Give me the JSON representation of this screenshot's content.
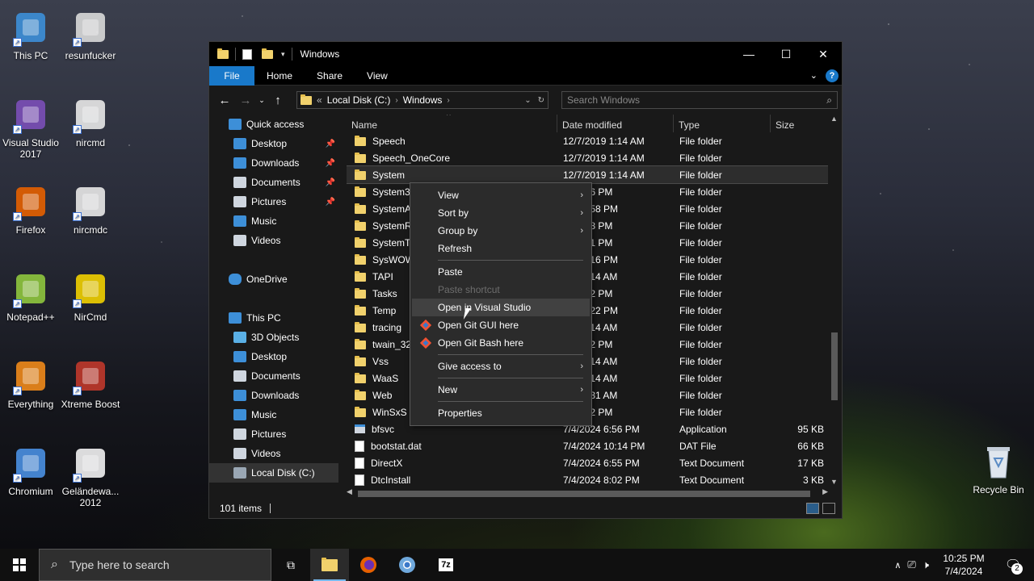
{
  "desktop": {
    "icons_left": [
      {
        "label": "This PC",
        "icon": "this-pc-icon"
      },
      {
        "label": "Visual Studio 2017",
        "icon": "visual-studio-icon"
      },
      {
        "label": "Firefox",
        "icon": "firefox-icon"
      },
      {
        "label": "Notepad++",
        "icon": "notepadpp-icon"
      },
      {
        "label": "Everything",
        "icon": "everything-icon"
      },
      {
        "label": "Chromium",
        "icon": "chromium-icon"
      }
    ],
    "icons_right": [
      {
        "label": "resunfucker",
        "icon": "gear-file-icon"
      },
      {
        "label": "nircmd",
        "icon": "nircmd-icon"
      },
      {
        "label": "nircmdc",
        "icon": "nircmdc-icon"
      },
      {
        "label": "NirCmd",
        "icon": "nircmd-question-icon"
      },
      {
        "label": "Xtreme Boost",
        "icon": "xtreme-boost-icon"
      },
      {
        "label": "Geländewa... 2012",
        "icon": "gelaendewagen-icon"
      }
    ],
    "recycle_bin": "Recycle Bin"
  },
  "explorer": {
    "title": "Windows",
    "ribbon_tabs": [
      "File",
      "Home",
      "Share",
      "View"
    ],
    "address": {
      "prefix": "«",
      "crumbs": [
        "Local Disk (C:)",
        "Windows"
      ]
    },
    "search_placeholder": "Search Windows",
    "nav": [
      {
        "label": "Quick access",
        "icon": "star-icon",
        "indent": 1,
        "pinned": false
      },
      {
        "label": "Desktop",
        "icon": "desktop-icon",
        "indent": 2,
        "pinned": true
      },
      {
        "label": "Downloads",
        "icon": "downloads-icon",
        "indent": 2,
        "pinned": true
      },
      {
        "label": "Documents",
        "icon": "documents-icon",
        "indent": 2,
        "pinned": true
      },
      {
        "label": "Pictures",
        "icon": "pictures-icon",
        "indent": 2,
        "pinned": true
      },
      {
        "label": "Music",
        "icon": "music-icon",
        "indent": 2,
        "pinned": false
      },
      {
        "label": "Videos",
        "icon": "videos-icon",
        "indent": 2,
        "pinned": false
      },
      {
        "label": "",
        "icon": "",
        "indent": 0,
        "pinned": false
      },
      {
        "label": "OneDrive",
        "icon": "onedrive-icon",
        "indent": 1,
        "pinned": false
      },
      {
        "label": "",
        "icon": "",
        "indent": 0,
        "pinned": false
      },
      {
        "label": "This PC",
        "icon": "this-pc-icon",
        "indent": 1,
        "pinned": false
      },
      {
        "label": "3D Objects",
        "icon": "3d-objects-icon",
        "indent": 2,
        "pinned": false
      },
      {
        "label": "Desktop",
        "icon": "desktop-icon",
        "indent": 2,
        "pinned": false
      },
      {
        "label": "Documents",
        "icon": "documents-icon",
        "indent": 2,
        "pinned": false
      },
      {
        "label": "Downloads",
        "icon": "downloads-icon",
        "indent": 2,
        "pinned": false
      },
      {
        "label": "Music",
        "icon": "music-icon",
        "indent": 2,
        "pinned": false
      },
      {
        "label": "Pictures",
        "icon": "pictures-icon",
        "indent": 2,
        "pinned": false
      },
      {
        "label": "Videos",
        "icon": "videos-icon",
        "indent": 2,
        "pinned": false
      },
      {
        "label": "Local Disk (C:)",
        "icon": "drive-icon",
        "indent": 2,
        "pinned": false,
        "selected": true
      },
      {
        "label": "",
        "icon": "",
        "indent": 0,
        "pinned": false
      },
      {
        "label": "Network",
        "icon": "network-icon",
        "indent": 1,
        "pinned": false
      }
    ],
    "columns": [
      "Name",
      "Date modified",
      "Type",
      "Size"
    ],
    "rows": [
      {
        "name": "Speech",
        "date": "12/7/2019 1:14 AM",
        "type": "File folder",
        "size": "",
        "kind": "folder"
      },
      {
        "name": "Speech_OneCore",
        "date": "12/7/2019 1:14 AM",
        "type": "File folder",
        "size": "",
        "kind": "folder"
      },
      {
        "name": "System",
        "date": "12/7/2019 1:14 AM",
        "type": "File folder",
        "size": "",
        "kind": "folder",
        "selected": true
      },
      {
        "name": "System32",
        "date": "4 10:16 PM",
        "type": "File folder",
        "size": "",
        "kind": "folder"
      },
      {
        "name": "SystemAp",
        "date": "023 2:58 PM",
        "type": "File folder",
        "size": "",
        "kind": "folder"
      },
      {
        "name": "SystemRe",
        "date": "24 7:08 PM",
        "type": "File folder",
        "size": "",
        "kind": "folder"
      },
      {
        "name": "SystemTer",
        "date": "24 3:51 PM",
        "type": "File folder",
        "size": "",
        "kind": "folder"
      },
      {
        "name": "SysWOW6",
        "date": "24 10:16 PM",
        "type": "File folder",
        "size": "",
        "kind": "folder"
      },
      {
        "name": "TAPI",
        "date": "019 1:14 AM",
        "type": "File folder",
        "size": "",
        "kind": "folder"
      },
      {
        "name": "Tasks",
        "date": "23 5:12 PM",
        "type": "File folder",
        "size": "",
        "kind": "folder"
      },
      {
        "name": "Temp",
        "date": "24 10:22 PM",
        "type": "File folder",
        "size": "",
        "kind": "folder"
      },
      {
        "name": "tracing",
        "date": "019 1:14 AM",
        "type": "File folder",
        "size": "",
        "kind": "folder"
      },
      {
        "name": "twain_32",
        "date": "24 1:22 PM",
        "type": "File folder",
        "size": "",
        "kind": "folder"
      },
      {
        "name": "Vss",
        "date": "019 1:14 AM",
        "type": "File folder",
        "size": "",
        "kind": "folder"
      },
      {
        "name": "WaaS",
        "date": "019 1:14 AM",
        "type": "File folder",
        "size": "",
        "kind": "folder"
      },
      {
        "name": "Web",
        "date": "019 1:31 AM",
        "type": "File folder",
        "size": "",
        "kind": "folder"
      },
      {
        "name": "WinSxS",
        "date": "24 8:22 PM",
        "type": "File folder",
        "size": "",
        "kind": "folder"
      },
      {
        "name": "bfsvc",
        "date": "7/4/2024 6:56 PM",
        "type": "Application",
        "size": "95 KB",
        "kind": "app"
      },
      {
        "name": "bootstat.dat",
        "date": "7/4/2024 10:14 PM",
        "type": "DAT File",
        "size": "66 KB",
        "kind": "file"
      },
      {
        "name": "DirectX",
        "date": "7/4/2024 6:55 PM",
        "type": "Text Document",
        "size": "17 KB",
        "kind": "file"
      },
      {
        "name": "DtcInstall",
        "date": "7/4/2024 8:02 PM",
        "type": "Text Document",
        "size": "3 KB",
        "kind": "file"
      }
    ],
    "status": "101 items"
  },
  "context_menu": [
    {
      "label": "View",
      "submenu": true
    },
    {
      "label": "Sort by",
      "submenu": true
    },
    {
      "label": "Group by",
      "submenu": true
    },
    {
      "label": "Refresh"
    },
    {
      "sep": true
    },
    {
      "label": "Paste"
    },
    {
      "label": "Paste shortcut",
      "disabled": true
    },
    {
      "label": "Open in Visual Studio",
      "hover": true
    },
    {
      "label": "Open Git GUI here",
      "icon": "git-icon"
    },
    {
      "label": "Open Git Bash here",
      "icon": "git-icon"
    },
    {
      "sep": true
    },
    {
      "label": "Give access to",
      "submenu": true
    },
    {
      "sep": true
    },
    {
      "label": "New",
      "submenu": true
    },
    {
      "sep": true
    },
    {
      "label": "Properties"
    }
  ],
  "taskbar": {
    "search_placeholder": "Type here to search",
    "apps": [
      "task-view-icon",
      "file-explorer-icon",
      "firefox-icon",
      "chromium-icon",
      "7zip-icon"
    ],
    "time": "10:25 PM",
    "date": "7/4/2024",
    "notification_count": "2"
  }
}
